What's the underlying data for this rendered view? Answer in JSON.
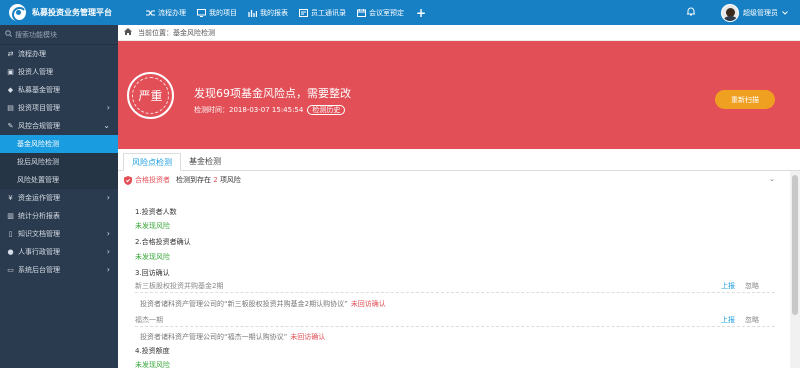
{
  "app": {
    "title": "私募投资业务管理平台"
  },
  "topnav": [
    {
      "label": "流程办理",
      "icon": "shuffle-icon"
    },
    {
      "label": "我的项目",
      "icon": "monitor-icon"
    },
    {
      "label": "我的报表",
      "icon": "bar-chart-icon"
    },
    {
      "label": "员工通讯录",
      "icon": "contact-card-icon"
    },
    {
      "label": "会议室预定",
      "icon": "calendar-icon"
    }
  ],
  "user": {
    "name": "超级管理员"
  },
  "sidebar": {
    "search_placeholder": "搜索功能模块",
    "items": [
      {
        "label": "流程办理"
      },
      {
        "label": "投资人管理"
      },
      {
        "label": "私募基金管理"
      },
      {
        "label": "投资项目管理"
      },
      {
        "label": "风控合规管理"
      },
      {
        "label": "基金风险检测"
      },
      {
        "label": "投后风险检测"
      },
      {
        "label": "风险处置管理"
      },
      {
        "label": "资金运作管理"
      },
      {
        "label": "统计分析报表"
      },
      {
        "label": "知识文档管理"
      },
      {
        "label": "人事行政管理"
      },
      {
        "label": "系统后台管理"
      }
    ]
  },
  "breadcrumb": {
    "prefix": "当前位置：",
    "current": "基金风险检测"
  },
  "alert": {
    "level": "严重",
    "title": "发现69项基金风险点，需要整改",
    "time_label": "检测时间：",
    "time_value": "2018-03-07 15:45:54",
    "history_label": "检测历史",
    "recheck_label": "重新扫描",
    "color": "#e24f57"
  },
  "tabs": [
    {
      "label": "风险点检测"
    },
    {
      "label": "基金检测"
    }
  ],
  "section": {
    "title": "合格投资者",
    "desc_prefix": "检测到存在",
    "count": "2",
    "desc_suffix": "项风险",
    "items": [
      {
        "label": "1.投资者人数",
        "status": "未发现风险"
      },
      {
        "label": "2.合格投资者确认",
        "status": "未发现风险"
      },
      {
        "label": "3.回访确认"
      },
      {
        "label": "4.投资额度",
        "status": "未发现风险"
      }
    ],
    "details": [
      {
        "name": "新三板股权投资并购基金2期",
        "note": "投资者诸科资产管理公司的“新三板股权投资并购基金2期认购协议”",
        "warn": "未回访确认",
        "report": "上报",
        "ignore": "忽略"
      },
      {
        "name": "福杰一期",
        "note": "投资者诸科资产管理公司的“福杰一期认购协议”",
        "warn": "未回访确认",
        "report": "上报",
        "ignore": "忽略"
      }
    ]
  }
}
